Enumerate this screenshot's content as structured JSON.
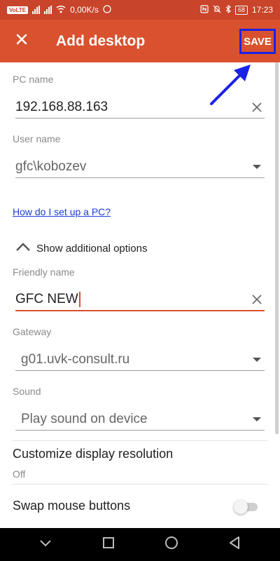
{
  "status_bar": {
    "carrier_badge": "VoLTE",
    "network_speed": "0,00K/s",
    "battery": "68",
    "time": "17:23"
  },
  "app_bar": {
    "title": "Add desktop",
    "save_label": "SAVE"
  },
  "form": {
    "pc_name": {
      "label": "PC name",
      "value": "192.168.88.163"
    },
    "user_name": {
      "label": "User name",
      "value": "gfc\\kobozev"
    },
    "help_link": "How do I set up a PC?",
    "options_toggle": "Show additional options",
    "friendly_name": {
      "label": "Friendly name",
      "value": "GFC NEW"
    },
    "gateway": {
      "label": "Gateway",
      "value": "g01.uvk-consult.ru"
    },
    "sound": {
      "label": "Sound",
      "value": "Play sound on device"
    }
  },
  "settings": {
    "display_resolution": {
      "title": "Customize display resolution",
      "value": "Off"
    },
    "swap_mouse": {
      "title": "Swap mouse buttons",
      "enabled": false
    }
  },
  "colors": {
    "app_bar": "#d9512e",
    "status_bar": "#c8442a",
    "highlight_box": "#1a22e6",
    "link": "#1a3fd6"
  },
  "icons": {
    "close": "close-icon",
    "clear": "clear-icon",
    "dropdown": "dropdown-arrow-icon",
    "chevron_up": "chevron-up-icon",
    "annotation_arrow": "arrow-icon"
  }
}
